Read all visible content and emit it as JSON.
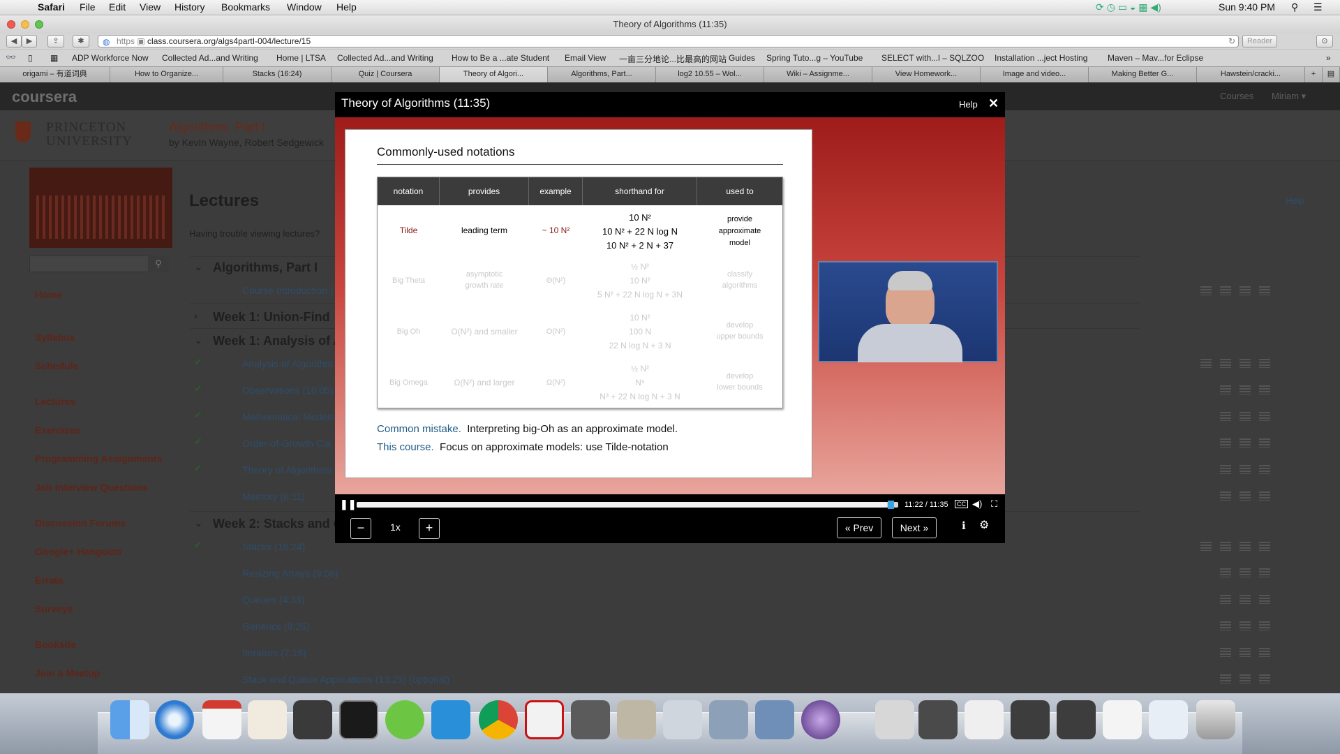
{
  "menubar": {
    "app": "Safari",
    "items": [
      "File",
      "Edit",
      "View",
      "History",
      "Bookmarks",
      "Window",
      "Help"
    ],
    "clock": "Sun 9:40 PM"
  },
  "window": {
    "title": "Theory of Algorithms (11:35)",
    "url_scheme": "https",
    "url": "class.coursera.org/algs4partI-004/lecture/15",
    "reader_label": "Reader"
  },
  "bookmarks": [
    "ADP Workforce Now",
    "Collected Ad...and Writing",
    "Home | LTSA",
    "Collected Ad...and Writing",
    "How to Be a ...ate Student",
    "Email View",
    "一亩三分地论...比最高的网站",
    "Guides",
    "Spring Tuto...g – YouTube",
    "SELECT with...l – SQLZOO",
    "Installation ...ject Hosting",
    "Maven – Mav...for Eclipse"
  ],
  "tabs": [
    "origami – 有道词典",
    "How to Organize...",
    "Stacks (16:24)",
    "Quiz | Coursera",
    "Theory of Algori...",
    "Algorithms, Part...",
    "log2 10.55 – Wol...",
    "Wiki – Assignme...",
    "View Homework...",
    "Image and video...",
    "Making Better G...",
    "Hawstein/cracki..."
  ],
  "coursera": {
    "logo": "coursera",
    "nav_courses": "Courses",
    "nav_user": "Miriam ▾",
    "university_line1": "PRINCETON",
    "university_line2": "UNIVERSITY",
    "course_title": "Algorithms, Part I",
    "course_authors": "by Kevin Wayne, Robert Sedgewick",
    "page_heading": "Lectures",
    "trouble_text": "Having trouble viewing lectures?",
    "help_link": "Help",
    "sidebar": [
      "Home",
      "Syllabus",
      "Schedule",
      "Lectures",
      "Exercises",
      "Programming Assignments",
      "Job Interview Questions",
      "Discussion Forums",
      "Google+ Hangouts",
      "Errata",
      "Surveys",
      "Booksite",
      "Join a Meetup"
    ],
    "sections": [
      {
        "title": "Algorithms, Part I",
        "lectures": [
          "Course Introduction ("
        ]
      },
      {
        "title": "Week 1: Union-Find",
        "lectures": []
      },
      {
        "title": "Week 1: Analysis of A",
        "lectures": [
          "Analysis of Algorithm",
          "Observations (10:05)",
          "Mathematical Models",
          "Order-of-Growth Cla",
          "Theory of Algorithms",
          "Memory (8:11)"
        ]
      },
      {
        "title": "Week 2: Stacks and Q",
        "lectures": [
          "Stacks (16:24)",
          "Resizing Arrays (9:56)",
          "Queues (4:33)",
          "Generics (9:26)",
          "Iterators (7:16)",
          "Stack and Queue Applications (13:25) (optional)"
        ]
      }
    ]
  },
  "modal": {
    "title": "Theory of Algorithms (11:35)",
    "help": "Help",
    "close": "✕"
  },
  "slide": {
    "heading": "Commonly-used notations",
    "headers": [
      "notation",
      "provides",
      "example",
      "shorthand for",
      "used to"
    ],
    "rows": [
      {
        "notation": "Tilde",
        "provides": "leading term",
        "example": "~ 10 N²",
        "shorthand": [
          "10 N²",
          "10 N² + 22 N log N",
          "10 N² + 2 N + 37"
        ],
        "used": [
          "provide",
          "approximate",
          "model"
        ]
      },
      {
        "notation": "Big Theta",
        "provides": [
          "asymptotic",
          "growth rate"
        ],
        "example": "Θ(N²)",
        "shorthand": [
          "½ N²",
          "10 N²",
          "5 N² + 22 N log N + 3N"
        ],
        "used": [
          "classify",
          "algorithms"
        ]
      },
      {
        "notation": "Big Oh",
        "provides": "O(N²) and smaller",
        "example": "O(N²)",
        "shorthand": [
          "10 N²",
          "100 N",
          "22 N log N + 3 N"
        ],
        "used": [
          "develop",
          "upper bounds"
        ]
      },
      {
        "notation": "Big Omega",
        "provides": "Ω(N²) and larger",
        "example": "Ω(N²)",
        "shorthand": [
          "½ N²",
          "N⁵",
          "N³ + 22 N log N + 3 N"
        ],
        "used": [
          "develop",
          "lower bounds"
        ]
      }
    ],
    "mistake_label": "Common mistake.",
    "mistake_text": "Interpreting big-Oh as an approximate model.",
    "course_label": "This course.",
    "course_text": "Focus on approximate models: use Tilde-notation"
  },
  "player": {
    "time": "11:22 / 11:35",
    "progress": 0.98,
    "speed": "1x",
    "minus": "−",
    "plus": "+",
    "prev": "« Prev",
    "next": "Next »",
    "cc": "CC"
  }
}
